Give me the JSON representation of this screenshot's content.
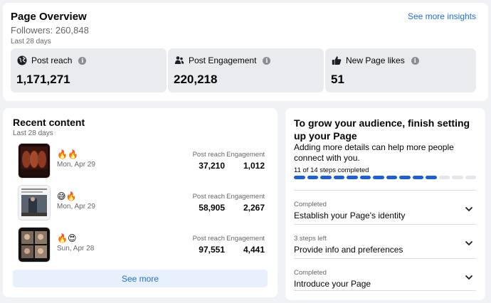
{
  "overview": {
    "title": "Page Overview",
    "followers": "Followers: 260,848",
    "period": "Last 28 days",
    "insights_link": "See more insights",
    "metrics": [
      {
        "icon": "globe-icon",
        "label": "Post reach",
        "value": "1,171,271"
      },
      {
        "icon": "people-icon",
        "label": "Post Engagement",
        "value": "220,218"
      },
      {
        "icon": "thumbs-up-icon",
        "label": "New Page likes",
        "value": "51"
      }
    ]
  },
  "recent": {
    "title": "Recent content",
    "period": "Last 28 days",
    "reach_label": "Post reach",
    "engagement_label": "Engagement",
    "posts": [
      {
        "emoji": "🔥🔥",
        "date": "Mon, Apr 29",
        "reach": "37,210",
        "engagement": "1,012"
      },
      {
        "emoji": "😅🔥",
        "date": "Mon, Apr 29",
        "reach": "58,905",
        "engagement": "2,267"
      },
      {
        "emoji": "🔥😍",
        "date": "Sun, Apr 28",
        "reach": "97,551",
        "engagement": "4,441"
      }
    ],
    "see_more": "See more"
  },
  "grow": {
    "title": "To grow your audience, finish setting up your Page",
    "description": "Adding more details can help more people connect with you.",
    "steps_text": "11 of 14 steps completed",
    "steps_done": 11,
    "steps_total": 14,
    "items": [
      {
        "status": "Completed",
        "label": "Establish your Page's identity"
      },
      {
        "status": "3 steps left",
        "label": "Provide info and preferences"
      },
      {
        "status": "Completed",
        "label": "Introduce your Page"
      }
    ]
  },
  "colors": {
    "accent": "#216fdb",
    "progress": "#1b5fd9",
    "background": "#f0f2f5"
  }
}
